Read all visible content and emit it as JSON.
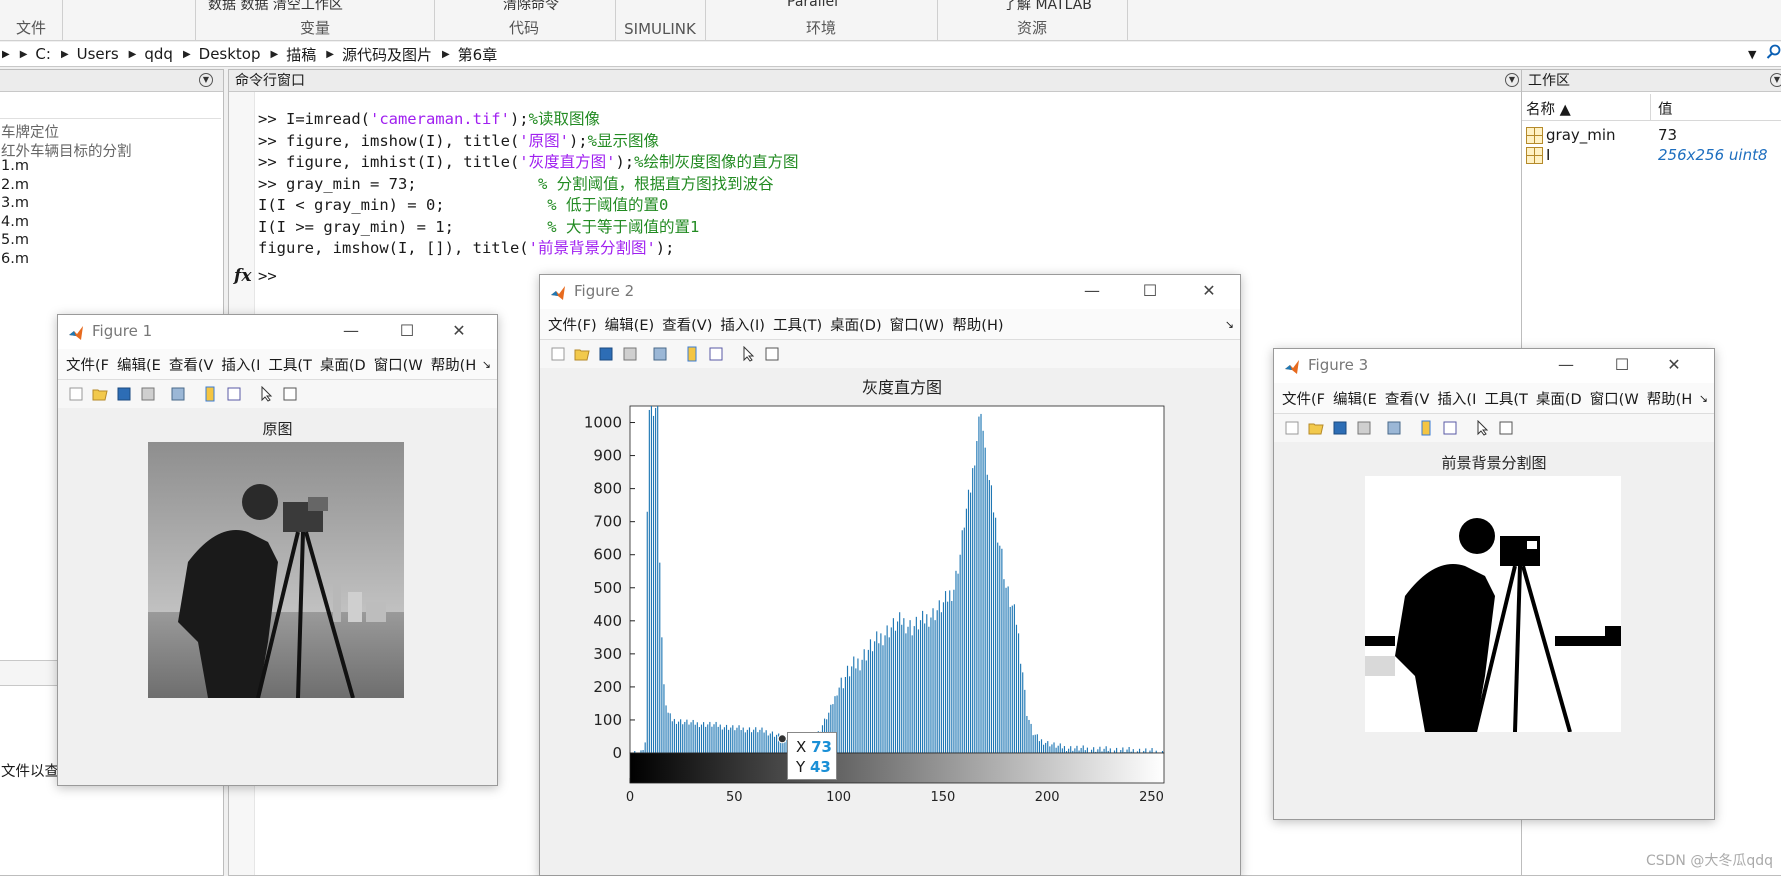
{
  "toolstrip": {
    "sections": [
      {
        "name": "文件",
        "top": ""
      },
      {
        "name": "变量",
        "top": "数据   数据   清空工作区"
      },
      {
        "name": "代码",
        "top": "清除命令"
      },
      {
        "name": "SIMULINK",
        "top": ""
      },
      {
        "name": "环境",
        "top": "Parallel"
      },
      {
        "name": "资源",
        "top": "了解 MATLAB"
      }
    ]
  },
  "address": [
    "C:",
    "Users",
    "qdq",
    "Desktop",
    "描稿",
    "源代码及图片",
    "第6章"
  ],
  "current_folder": {
    "items": [
      "车牌定位",
      "红外车辆目标的分割",
      "1.m",
      "2.m",
      "3.m",
      "4.m",
      "5.m",
      "6.m"
    ],
    "details_text": "文件以查"
  },
  "command_window": {
    "title": "命令行窗口",
    "lines": [
      [
        {
          "t": ">> I=imread("
        },
        {
          "t": "'cameraman.tif'",
          "c": "str"
        },
        {
          "t": ");"
        },
        {
          "t": "%读取图像",
          "c": "cmt"
        }
      ],
      [
        {
          "t": ">> figure, imshow(I), title("
        },
        {
          "t": "'原图'",
          "c": "str"
        },
        {
          "t": ");"
        },
        {
          "t": "%显示图像",
          "c": "cmt"
        }
      ],
      [
        {
          "t": ">> figure, imhist(I), title("
        },
        {
          "t": "'灰度直方图'",
          "c": "str"
        },
        {
          "t": ");"
        },
        {
          "t": "%绘制灰度图像的直方图",
          "c": "cmt"
        }
      ],
      [
        {
          "t": ">> gray_min = 73;             "
        },
        {
          "t": "% 分割阈值，根据直方图找到波谷",
          "c": "cmt"
        }
      ],
      [
        {
          "t": "I(I < gray_min) = 0;           "
        },
        {
          "t": "% 低于阈值的置0",
          "c": "cmt"
        }
      ],
      [
        {
          "t": "I(I >= gray_min) = 1;          "
        },
        {
          "t": "% 大于等于阈值的置1",
          "c": "cmt"
        }
      ],
      [
        {
          "t": "figure, imshow(I, []), title("
        },
        {
          "t": "'前景背景分割图'",
          "c": "str"
        },
        {
          "t": ");"
        }
      ]
    ],
    "prompt": ">>",
    "fx": "fx"
  },
  "workspace": {
    "title": "工作区",
    "col_name": "名称 ▲",
    "col_value": "值",
    "rows": [
      {
        "name": "gray_min",
        "value": "73"
      },
      {
        "name": "I",
        "value": "256x256 uint8"
      }
    ]
  },
  "figure1": {
    "title": "Figure 1",
    "menus": [
      "文件(F",
      "编辑(E",
      "查看(V",
      "插入(I",
      "工具(T",
      "桌面(D",
      "窗口(W",
      "帮助(H"
    ],
    "axes_title": "原图"
  },
  "figure2": {
    "title": "Figure 2",
    "menus": [
      "文件(F)",
      "编辑(E)",
      "查看(V)",
      "插入(I)",
      "工具(T)",
      "桌面(D)",
      "窗口(W)",
      "帮助(H)"
    ],
    "datatip": {
      "x_label": "X",
      "x_value": "73",
      "y_label": "Y",
      "y_value": "43"
    }
  },
  "figure3": {
    "title": "Figure 3",
    "menus": [
      "文件(F",
      "编辑(E",
      "查看(V",
      "插入(I",
      "工具(T",
      "桌面(D",
      "窗口(W",
      "帮助(H"
    ],
    "axes_title": "前景背景分割图"
  },
  "chart_data": {
    "type": "bar",
    "title": "灰度直方图",
    "xlabel": "",
    "ylabel": "",
    "xlim": [
      0,
      256
    ],
    "ylim": [
      0,
      1050
    ],
    "xticks": [
      0,
      50,
      100,
      150,
      200,
      250
    ],
    "yticks": [
      0,
      100,
      200,
      300,
      400,
      500,
      600,
      700,
      800,
      900,
      1000
    ],
    "anchors_x": [
      0,
      5,
      7,
      8,
      9,
      10,
      11,
      12,
      13,
      14,
      15,
      16,
      17,
      18,
      19,
      20,
      25,
      30,
      40,
      50,
      60,
      65,
      70,
      73,
      80,
      90,
      95,
      100,
      105,
      110,
      115,
      120,
      125,
      130,
      135,
      140,
      145,
      150,
      155,
      158,
      160,
      163,
      165,
      168,
      170,
      175,
      178,
      180,
      185,
      188,
      190,
      193,
      196,
      200,
      205,
      210,
      220,
      230,
      240,
      250,
      255
    ],
    "anchors_y": [
      0,
      0,
      30,
      700,
      1050,
      1050,
      1050,
      1050,
      1050,
      600,
      350,
      200,
      150,
      120,
      110,
      100,
      95,
      90,
      85,
      75,
      70,
      65,
      55,
      43,
      45,
      60,
      120,
      200,
      250,
      280,
      320,
      350,
      380,
      400,
      380,
      400,
      420,
      450,
      500,
      600,
      700,
      800,
      900,
      1050,
      900,
      700,
      600,
      500,
      400,
      250,
      120,
      60,
      40,
      30,
      20,
      15,
      12,
      10,
      8,
      5,
      0
    ],
    "colorbar": true
  }
}
